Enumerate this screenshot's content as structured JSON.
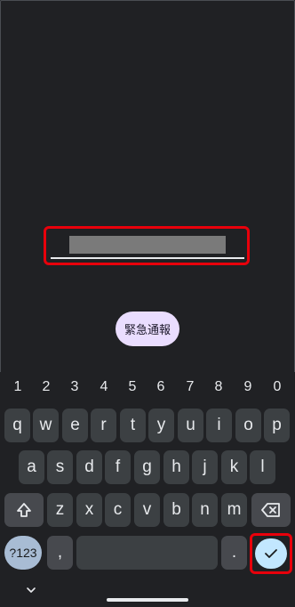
{
  "lock_screen": {
    "emergency_label": "緊急通報"
  },
  "keyboard": {
    "numbers": [
      "1",
      "2",
      "3",
      "4",
      "5",
      "6",
      "7",
      "8",
      "9",
      "0"
    ],
    "row1": [
      "q",
      "w",
      "e",
      "r",
      "t",
      "y",
      "u",
      "i",
      "o",
      "p"
    ],
    "row2": [
      "a",
      "s",
      "d",
      "f",
      "g",
      "h",
      "j",
      "k",
      "l"
    ],
    "row3": [
      "z",
      "x",
      "c",
      "v",
      "b",
      "n",
      "m"
    ],
    "symbols_label": "?123",
    "comma": ",",
    "period": ".",
    "icons": {
      "shift": "shift-icon",
      "backspace": "backspace-icon",
      "enter": "checkmark-icon",
      "hide": "chevron-down-icon"
    }
  },
  "colors": {
    "background": "#202124",
    "key": "#3c4043",
    "highlight_border": "#e8000b",
    "enter_key": "#c2e7ff",
    "emergency_button": "#eaddff"
  }
}
